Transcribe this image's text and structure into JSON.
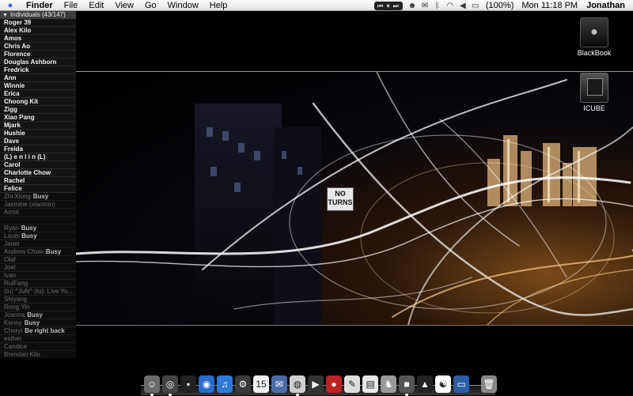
{
  "menubar": {
    "apple_icon": "apple-icon",
    "app_name": "Finder",
    "menus": [
      "File",
      "Edit",
      "View",
      "Go",
      "Window",
      "Help"
    ],
    "media_controls": "⏮ ⏸ ⏭",
    "battery": "(100%)",
    "clock": "Mon 11:18 PM",
    "user": "Jonathan"
  },
  "contacts": {
    "group_title": "Individuals (43/147)",
    "online": [
      "Roger 39",
      "Alex Kilo",
      "Amos",
      "Chris Ao",
      "Florence",
      "Douglas Ashborn",
      "Fredrick",
      "Ann",
      "Winnie",
      "Erica",
      "Choong Kit",
      "Zigg",
      "Xiao Pang",
      "Mjark",
      "Hushie",
      "Dave",
      "Freida",
      "(L) e n l i n (L)",
      "Carol",
      "Charlotte Chow",
      "Rachel",
      "Felice"
    ],
    "offline": [
      {
        "name": "Zhi Xiong",
        "status": "Busy"
      },
      {
        "name": "Jasmine (xiaomin)",
        "status": ""
      },
      {
        "name": "Armit",
        "status": ""
      },
      {
        "name": "",
        "status": ""
      },
      {
        "name": "Ryan",
        "status": "Busy"
      },
      {
        "name": "Louis",
        "status": "Busy"
      },
      {
        "name": "Janet",
        "status": ""
      },
      {
        "name": "Andrew Chow",
        "status": "Busy"
      },
      {
        "name": "Olaf",
        "status": ""
      },
      {
        "name": "Joel",
        "status": ""
      },
      {
        "name": "Ivan",
        "status": ""
      },
      {
        "name": "RuiFang",
        "status": ""
      },
      {
        "name": "(tu) ^JuN^ (tu): Live Yo...",
        "status": ""
      },
      {
        "name": "Shiyang",
        "status": ""
      },
      {
        "name": "Rong Yin",
        "status": ""
      },
      {
        "name": "Joanna",
        "status": "Busy"
      },
      {
        "name": "Kenny",
        "status": "Busy"
      },
      {
        "name": "Cheryl",
        "status": "Be right back"
      },
      {
        "name": "esther",
        "status": ""
      },
      {
        "name": "Candice",
        "status": ""
      },
      {
        "name": "Brendan Kilo",
        "status": ""
      }
    ]
  },
  "desktop": {
    "icons": [
      {
        "label": "BlackBook",
        "icon": "hard-drive-icon"
      },
      {
        "label": "ICUBE",
        "icon": "ipod-icon"
      }
    ],
    "sign_text": "NO TURNS"
  },
  "dock": {
    "items": [
      "finder-icon",
      "dashboard-icon",
      "terminal-icon",
      "safari-icon",
      "itunes-icon",
      "system-preferences-icon",
      "ical-icon",
      "mail-icon",
      "dvd-player-icon",
      "front-row-icon",
      "photo-booth-icon",
      "textedit-icon",
      "preview-icon",
      "chess-icon",
      "cube-app-icon",
      "stocks-icon",
      "yin-yang-icon",
      "monitor-icon",
      "trash-icon"
    ]
  }
}
